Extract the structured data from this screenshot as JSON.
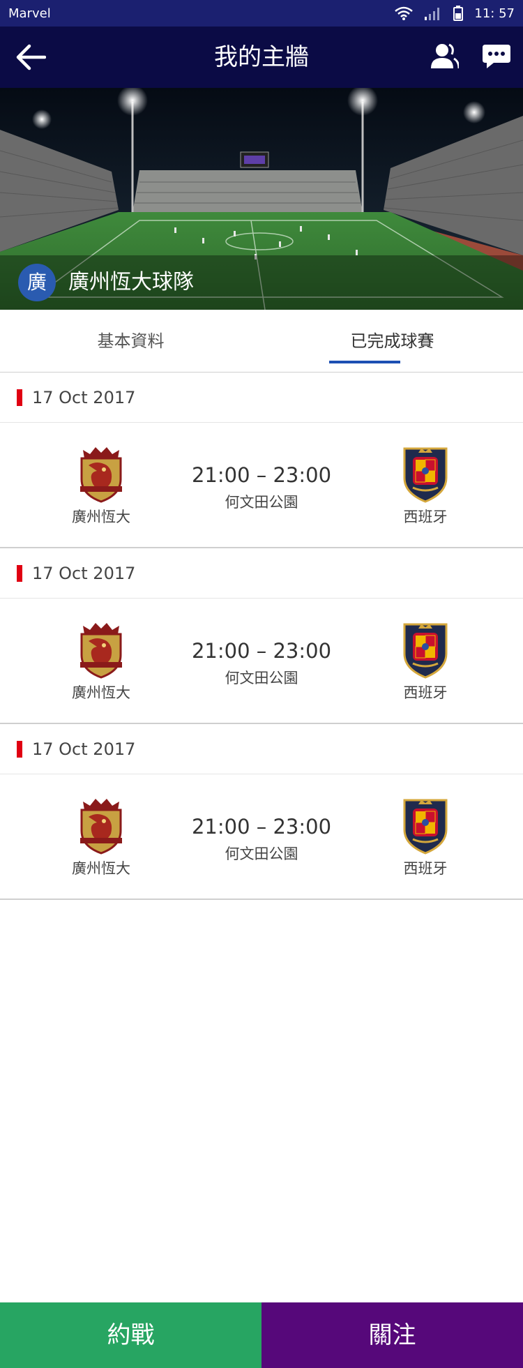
{
  "status_bar": {
    "carrier": "Marvel",
    "time": "11: 57"
  },
  "nav": {
    "title": "我的主牆"
  },
  "team": {
    "avatar_char": "廣",
    "name": "廣州恆大球隊"
  },
  "tabs": [
    {
      "label": "基本資料",
      "active": false
    },
    {
      "label": "已完成球賽",
      "active": true
    }
  ],
  "matches": [
    {
      "date": "17 Oct 2017",
      "home": "廣州恆大",
      "away": "西班牙",
      "time": "21:00 – 23:00",
      "venue": "何文田公園"
    },
    {
      "date": "17 Oct 2017",
      "home": "廣州恆大",
      "away": "西班牙",
      "time": "21:00 – 23:00",
      "venue": "何文田公園"
    },
    {
      "date": "17 Oct 2017",
      "home": "廣州恆大",
      "away": "西班牙",
      "time": "21:00 – 23:00",
      "venue": "何文田公園"
    }
  ],
  "buttons": {
    "challenge": "約戰",
    "follow": "關注"
  },
  "colors": {
    "status_bar": "#1b2070",
    "nav_bar": "#0b0b45",
    "tab_underline": "#1d4fb3",
    "date_marker": "#e00012",
    "challenge_button": "#27a562",
    "follow_button": "#56087a"
  }
}
